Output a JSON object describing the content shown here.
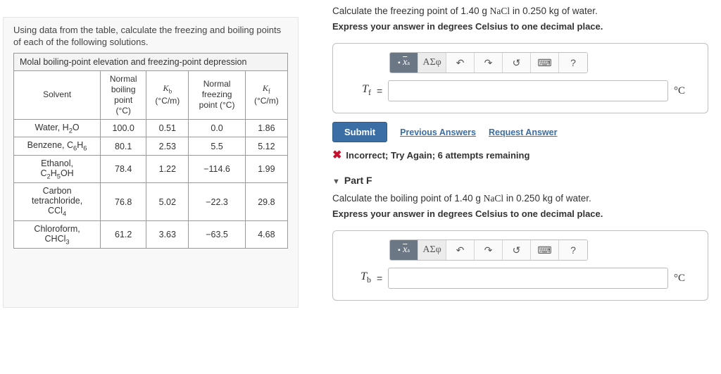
{
  "left": {
    "intro": "Using data from the table, calculate the freezing and boiling points of each of the following solutions.",
    "table_title": "Molal boiling-point elevation and freezing-point depression",
    "headers": {
      "solvent": "Solvent",
      "nbp_l1": "Normal",
      "nbp_l2": "boiling",
      "nbp_l3": "point",
      "nbp_l4": "(°C)",
      "kb_l1": "K",
      "kb_l2": "(°C/m)",
      "nfp_l1": "Normal",
      "nfp_l2": "freezing",
      "nfp_l3": "point (°C)",
      "kf_l1": "K",
      "kf_l2": "(°C/m)"
    },
    "rows": [
      {
        "name_html": "Water, H<sub>2</sub>O",
        "nbp": "100.0",
        "kb": "0.51",
        "nfp": "0.0",
        "kf": "1.86"
      },
      {
        "name_html": "Benzene, C<sub>6</sub>H<sub>6</sub>",
        "nbp": "80.1",
        "kb": "2.53",
        "nfp": "5.5",
        "kf": "5.12"
      },
      {
        "name_html": "Ethanol,<br>C<sub>2</sub>H<sub>5</sub>OH",
        "nbp": "78.4",
        "kb": "1.22",
        "nfp": "−114.6",
        "kf": "1.99"
      },
      {
        "name_html": "Carbon<br>tetrachloride,<br>CCl<sub>4</sub>",
        "nbp": "76.8",
        "kb": "5.02",
        "nfp": "−22.3",
        "kf": "29.8"
      },
      {
        "name_html": "Chloroform,<br>CHCl<sub>3</sub>",
        "nbp": "61.2",
        "kb": "3.63",
        "nfp": "−63.5",
        "kf": "4.68"
      }
    ]
  },
  "right": {
    "e": {
      "prompt_pre": "Calculate the freezing point of 1.40 g ",
      "prompt_chem": "NaCl",
      "prompt_post": " in 0.250 kg of water.",
      "instruct": "Express your answer in degrees Celsius to one decimal place.",
      "var": "T",
      "var_sub": "f",
      "unit": "°C",
      "submit": "Submit",
      "prev": "Previous Answers",
      "req": "Request Answer",
      "feedback": "Incorrect; Try Again; 6 attempts remaining"
    },
    "f": {
      "header": "Part F",
      "prompt_pre": "Calculate the boiling point of 1.40 g ",
      "prompt_chem": "NaCl",
      "prompt_post": " in 0.250 kg of water.",
      "instruct": "Express your answer in degrees Celsius to one decimal place.",
      "var": "T",
      "var_sub": "b",
      "unit": "°C"
    },
    "toolbar": {
      "templates": "x",
      "sigma": "ΑΣφ",
      "undo": "↶",
      "redo": "↷",
      "reset": "↺",
      "keyboard": "⌨",
      "help": "?"
    }
  }
}
